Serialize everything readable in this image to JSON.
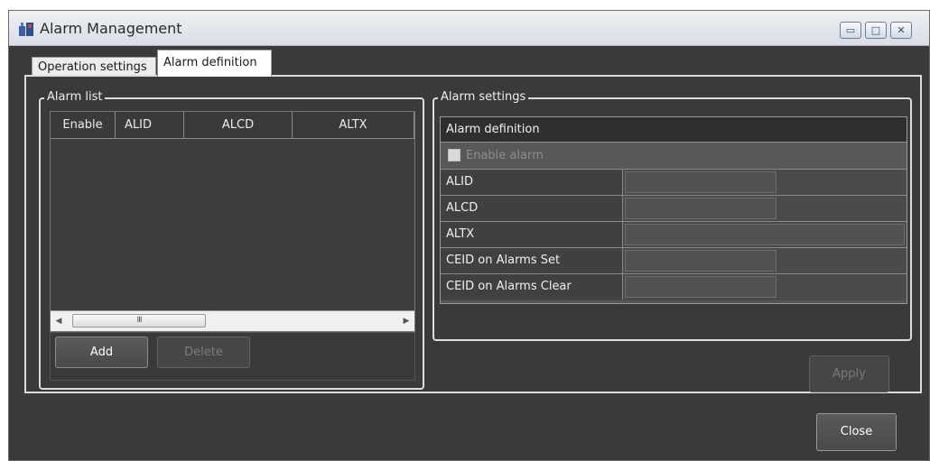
{
  "window": {
    "title": "Alarm Management",
    "controls": {
      "minimize": "▭",
      "maximize": "□",
      "close": "✕"
    }
  },
  "tabs": [
    {
      "label": "Operation settings",
      "active": false
    },
    {
      "label": "Alarm definition",
      "active": true
    }
  ],
  "alarm_list": {
    "group_label": "Alarm list",
    "columns": [
      "Enable",
      "ALID",
      "ALCD",
      "ALTX"
    ],
    "rows": [],
    "scroll": {
      "left": "◀",
      "thumb": "III",
      "right": "▶"
    },
    "add_label": "Add",
    "delete_label": "Delete"
  },
  "alarm_settings": {
    "group_label": "Alarm settings",
    "header": "Alarm definition",
    "enable_label": "Enable alarm",
    "fields": [
      {
        "label": "ALID",
        "value": ""
      },
      {
        "label": "ALCD",
        "value": ""
      },
      {
        "label": "ALTX",
        "value": ""
      },
      {
        "label": "CEID on Alarms Set",
        "value": ""
      },
      {
        "label": "CEID on Alarms Clear",
        "value": ""
      }
    ],
    "apply_label": "Apply"
  },
  "footer": {
    "close_label": "Close"
  },
  "colors": {
    "background": "#3a3a3a",
    "border": "#dcdcdc",
    "header": "#2f2f2f"
  }
}
